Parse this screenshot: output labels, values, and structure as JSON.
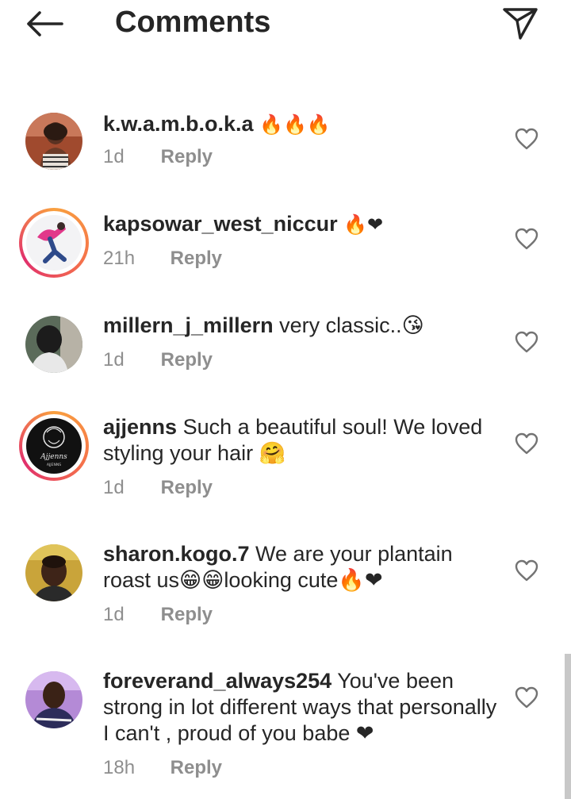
{
  "header": {
    "title": "Comments",
    "back_icon": "arrow-left-icon",
    "share_icon": "paper-plane-icon"
  },
  "colors": {
    "text": "#262626",
    "muted": "#8e8e8e",
    "heart": "#e0457b",
    "story_ring": [
      "#f9a03f",
      "#e1306c"
    ]
  },
  "comments": [
    {
      "username": "k.w.a.m.b.o.k.a",
      "text": "🔥🔥🔥",
      "time": "1d",
      "reply_label": "Reply",
      "story_ring": false
    },
    {
      "username": "kapsowar_west_niccur",
      "text": "🔥❤",
      "time": "21h",
      "reply_label": "Reply",
      "story_ring": true
    },
    {
      "username": "millern_j_millern",
      "text": "very classic..😘",
      "time": "1d",
      "reply_label": "Reply",
      "story_ring": false
    },
    {
      "username": "ajjenns",
      "text": "Such a beautiful soul! We loved styling your hair 🤗",
      "time": "1d",
      "reply_label": "Reply",
      "story_ring": true,
      "avatar_text": "Ajjenns",
      "avatar_subtext": "AJJENNS"
    },
    {
      "username": "sharon.kogo.7",
      "text": "We are your plantain roast us😁😁looking cute🔥❤",
      "time": "1d",
      "reply_label": "Reply",
      "story_ring": false
    },
    {
      "username": "foreverand_always254",
      "text": "You've been strong in lot different ways that personally I can't , proud of you babe ❤",
      "time": "18h",
      "reply_label": "Reply",
      "story_ring": false
    }
  ]
}
